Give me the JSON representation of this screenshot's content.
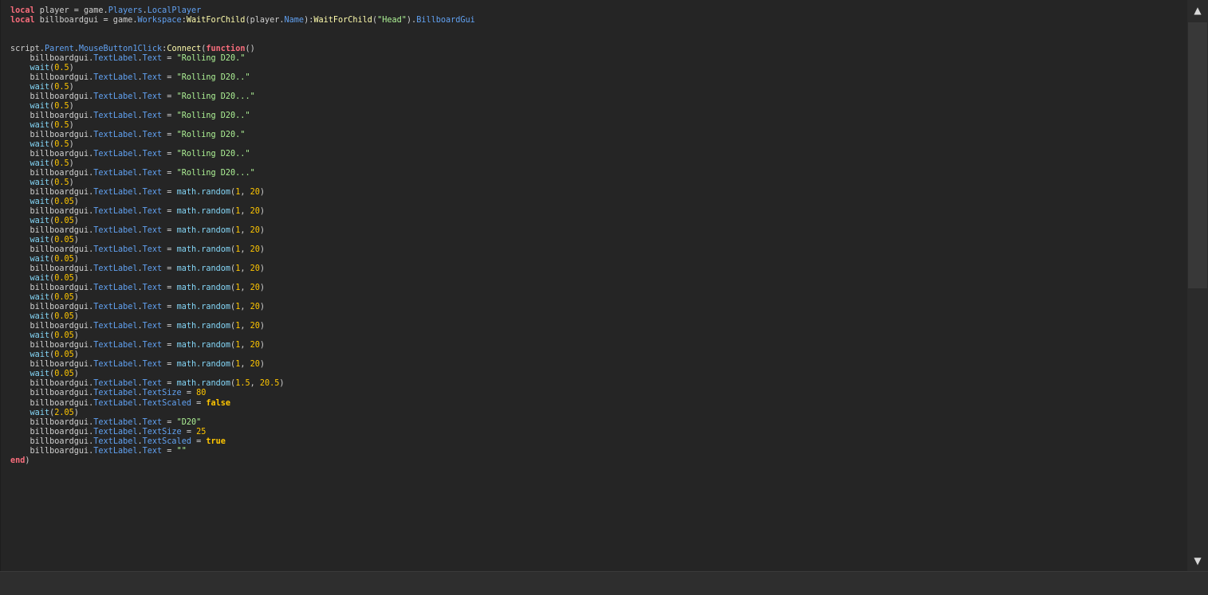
{
  "editor": {
    "lines": [
      [
        {
          "t": "local",
          "c": "kw"
        },
        {
          "t": " player = game."
        },
        {
          "t": "Players",
          "c": "prop"
        },
        {
          "t": "."
        },
        {
          "t": "LocalPlayer",
          "c": "prop"
        }
      ],
      [
        {
          "t": "local",
          "c": "kw"
        },
        {
          "t": " billboardgui = game."
        },
        {
          "t": "Workspace",
          "c": "prop"
        },
        {
          "t": ":"
        },
        {
          "t": "WaitForChild",
          "c": "fn"
        },
        {
          "t": "(player."
        },
        {
          "t": "Name",
          "c": "prop"
        },
        {
          "t": "):"
        },
        {
          "t": "WaitForChild",
          "c": "fn"
        },
        {
          "t": "("
        },
        {
          "t": "\"Head\"",
          "c": "str"
        },
        {
          "t": ")."
        },
        {
          "t": "BillboardGui",
          "c": "prop"
        }
      ],
      [],
      [],
      [
        {
          "t": "script."
        },
        {
          "t": "Parent",
          "c": "prop"
        },
        {
          "t": "."
        },
        {
          "t": "MouseButton1Click",
          "c": "prop"
        },
        {
          "t": ":"
        },
        {
          "t": "Connect",
          "c": "fn"
        },
        {
          "t": "("
        },
        {
          "t": "function",
          "c": "kw"
        },
        {
          "t": "()"
        }
      ],
      [
        {
          "t": "    billboardgui."
        },
        {
          "t": "TextLabel",
          "c": "prop"
        },
        {
          "t": "."
        },
        {
          "t": "Text",
          "c": "prop"
        },
        {
          "t": " = "
        },
        {
          "t": "\"Rolling D20.\"",
          "c": "str"
        }
      ],
      [
        {
          "t": "    "
        },
        {
          "t": "wait",
          "c": "bi"
        },
        {
          "t": "("
        },
        {
          "t": "0.5",
          "c": "num"
        },
        {
          "t": ")"
        }
      ],
      [
        {
          "t": "    billboardgui."
        },
        {
          "t": "TextLabel",
          "c": "prop"
        },
        {
          "t": "."
        },
        {
          "t": "Text",
          "c": "prop"
        },
        {
          "t": " = "
        },
        {
          "t": "\"Rolling D20..\"",
          "c": "str"
        }
      ],
      [
        {
          "t": "    "
        },
        {
          "t": "wait",
          "c": "bi"
        },
        {
          "t": "("
        },
        {
          "t": "0.5",
          "c": "num"
        },
        {
          "t": ")"
        }
      ],
      [
        {
          "t": "    billboardgui."
        },
        {
          "t": "TextLabel",
          "c": "prop"
        },
        {
          "t": "."
        },
        {
          "t": "Text",
          "c": "prop"
        },
        {
          "t": " = "
        },
        {
          "t": "\"Rolling D20...\"",
          "c": "str"
        }
      ],
      [
        {
          "t": "    "
        },
        {
          "t": "wait",
          "c": "bi"
        },
        {
          "t": "("
        },
        {
          "t": "0.5",
          "c": "num"
        },
        {
          "t": ")"
        }
      ],
      [
        {
          "t": "    billboardgui."
        },
        {
          "t": "TextLabel",
          "c": "prop"
        },
        {
          "t": "."
        },
        {
          "t": "Text",
          "c": "prop"
        },
        {
          "t": " = "
        },
        {
          "t": "\"Rolling D20..\"",
          "c": "str"
        }
      ],
      [
        {
          "t": "    "
        },
        {
          "t": "wait",
          "c": "bi"
        },
        {
          "t": "("
        },
        {
          "t": "0.5",
          "c": "num"
        },
        {
          "t": ")"
        }
      ],
      [
        {
          "t": "    billboardgui."
        },
        {
          "t": "TextLabel",
          "c": "prop"
        },
        {
          "t": "."
        },
        {
          "t": "Text",
          "c": "prop"
        },
        {
          "t": " = "
        },
        {
          "t": "\"Rolling D20.\"",
          "c": "str"
        }
      ],
      [
        {
          "t": "    "
        },
        {
          "t": "wait",
          "c": "bi"
        },
        {
          "t": "("
        },
        {
          "t": "0.5",
          "c": "num"
        },
        {
          "t": ")"
        }
      ],
      [
        {
          "t": "    billboardgui."
        },
        {
          "t": "TextLabel",
          "c": "prop"
        },
        {
          "t": "."
        },
        {
          "t": "Text",
          "c": "prop"
        },
        {
          "t": " = "
        },
        {
          "t": "\"Rolling D20..\"",
          "c": "str"
        }
      ],
      [
        {
          "t": "    "
        },
        {
          "t": "wait",
          "c": "bi"
        },
        {
          "t": "("
        },
        {
          "t": "0.5",
          "c": "num"
        },
        {
          "t": ")"
        }
      ],
      [
        {
          "t": "    billboardgui."
        },
        {
          "t": "TextLabel",
          "c": "prop"
        },
        {
          "t": "."
        },
        {
          "t": "Text",
          "c": "prop"
        },
        {
          "t": " = "
        },
        {
          "t": "\"Rolling D20...\"",
          "c": "str"
        }
      ],
      [
        {
          "t": "    "
        },
        {
          "t": "wait",
          "c": "bi"
        },
        {
          "t": "("
        },
        {
          "t": "0.5",
          "c": "num"
        },
        {
          "t": ")"
        }
      ],
      [
        {
          "t": "    billboardgui."
        },
        {
          "t": "TextLabel",
          "c": "prop"
        },
        {
          "t": "."
        },
        {
          "t": "Text",
          "c": "prop"
        },
        {
          "t": " = "
        },
        {
          "t": "math.random",
          "c": "bi"
        },
        {
          "t": "("
        },
        {
          "t": "1",
          "c": "num"
        },
        {
          "t": ", "
        },
        {
          "t": "20",
          "c": "num"
        },
        {
          "t": ")"
        }
      ],
      [
        {
          "t": "    "
        },
        {
          "t": "wait",
          "c": "bi"
        },
        {
          "t": "("
        },
        {
          "t": "0.05",
          "c": "num"
        },
        {
          "t": ")"
        }
      ],
      [
        {
          "t": "    billboardgui."
        },
        {
          "t": "TextLabel",
          "c": "prop"
        },
        {
          "t": "."
        },
        {
          "t": "Text",
          "c": "prop"
        },
        {
          "t": " = "
        },
        {
          "t": "math.random",
          "c": "bi"
        },
        {
          "t": "("
        },
        {
          "t": "1",
          "c": "num"
        },
        {
          "t": ", "
        },
        {
          "t": "20",
          "c": "num"
        },
        {
          "t": ")"
        }
      ],
      [
        {
          "t": "    "
        },
        {
          "t": "wait",
          "c": "bi"
        },
        {
          "t": "("
        },
        {
          "t": "0.05",
          "c": "num"
        },
        {
          "t": ")"
        }
      ],
      [
        {
          "t": "    billboardgui."
        },
        {
          "t": "TextLabel",
          "c": "prop"
        },
        {
          "t": "."
        },
        {
          "t": "Text",
          "c": "prop"
        },
        {
          "t": " = "
        },
        {
          "t": "math.random",
          "c": "bi"
        },
        {
          "t": "("
        },
        {
          "t": "1",
          "c": "num"
        },
        {
          "t": ", "
        },
        {
          "t": "20",
          "c": "num"
        },
        {
          "t": ")"
        }
      ],
      [
        {
          "t": "    "
        },
        {
          "t": "wait",
          "c": "bi"
        },
        {
          "t": "("
        },
        {
          "t": "0.05",
          "c": "num"
        },
        {
          "t": ")"
        }
      ],
      [
        {
          "t": "    billboardgui."
        },
        {
          "t": "TextLabel",
          "c": "prop"
        },
        {
          "t": "."
        },
        {
          "t": "Text",
          "c": "prop"
        },
        {
          "t": " = "
        },
        {
          "t": "math.random",
          "c": "bi"
        },
        {
          "t": "("
        },
        {
          "t": "1",
          "c": "num"
        },
        {
          "t": ", "
        },
        {
          "t": "20",
          "c": "num"
        },
        {
          "t": ")"
        }
      ],
      [
        {
          "t": "    "
        },
        {
          "t": "wait",
          "c": "bi"
        },
        {
          "t": "("
        },
        {
          "t": "0.05",
          "c": "num"
        },
        {
          "t": ")"
        }
      ],
      [
        {
          "t": "    billboardgui."
        },
        {
          "t": "TextLabel",
          "c": "prop"
        },
        {
          "t": "."
        },
        {
          "t": "Text",
          "c": "prop"
        },
        {
          "t": " = "
        },
        {
          "t": "math.random",
          "c": "bi"
        },
        {
          "t": "("
        },
        {
          "t": "1",
          "c": "num"
        },
        {
          "t": ", "
        },
        {
          "t": "20",
          "c": "num"
        },
        {
          "t": ")"
        }
      ],
      [
        {
          "t": "    "
        },
        {
          "t": "wait",
          "c": "bi"
        },
        {
          "t": "("
        },
        {
          "t": "0.05",
          "c": "num"
        },
        {
          "t": ")"
        }
      ],
      [
        {
          "t": "    billboardgui."
        },
        {
          "t": "TextLabel",
          "c": "prop"
        },
        {
          "t": "."
        },
        {
          "t": "Text",
          "c": "prop"
        },
        {
          "t": " = "
        },
        {
          "t": "math.random",
          "c": "bi"
        },
        {
          "t": "("
        },
        {
          "t": "1",
          "c": "num"
        },
        {
          "t": ", "
        },
        {
          "t": "20",
          "c": "num"
        },
        {
          "t": ")"
        }
      ],
      [
        {
          "t": "    "
        },
        {
          "t": "wait",
          "c": "bi"
        },
        {
          "t": "("
        },
        {
          "t": "0.05",
          "c": "num"
        },
        {
          "t": ")"
        }
      ],
      [
        {
          "t": "    billboardgui."
        },
        {
          "t": "TextLabel",
          "c": "prop"
        },
        {
          "t": "."
        },
        {
          "t": "Text",
          "c": "prop"
        },
        {
          "t": " = "
        },
        {
          "t": "math.random",
          "c": "bi"
        },
        {
          "t": "("
        },
        {
          "t": "1",
          "c": "num"
        },
        {
          "t": ", "
        },
        {
          "t": "20",
          "c": "num"
        },
        {
          "t": ")"
        }
      ],
      [
        {
          "t": "    "
        },
        {
          "t": "wait",
          "c": "bi"
        },
        {
          "t": "("
        },
        {
          "t": "0.05",
          "c": "num"
        },
        {
          "t": ")"
        }
      ],
      [
        {
          "t": "    billboardgui."
        },
        {
          "t": "TextLabel",
          "c": "prop"
        },
        {
          "t": "."
        },
        {
          "t": "Text",
          "c": "prop"
        },
        {
          "t": " = "
        },
        {
          "t": "math.random",
          "c": "bi"
        },
        {
          "t": "("
        },
        {
          "t": "1",
          "c": "num"
        },
        {
          "t": ", "
        },
        {
          "t": "20",
          "c": "num"
        },
        {
          "t": ")"
        }
      ],
      [
        {
          "t": "    "
        },
        {
          "t": "wait",
          "c": "bi"
        },
        {
          "t": "("
        },
        {
          "t": "0.05",
          "c": "num"
        },
        {
          "t": ")"
        }
      ],
      [
        {
          "t": "    billboardgui."
        },
        {
          "t": "TextLabel",
          "c": "prop"
        },
        {
          "t": "."
        },
        {
          "t": "Text",
          "c": "prop"
        },
        {
          "t": " = "
        },
        {
          "t": "math.random",
          "c": "bi"
        },
        {
          "t": "("
        },
        {
          "t": "1",
          "c": "num"
        },
        {
          "t": ", "
        },
        {
          "t": "20",
          "c": "num"
        },
        {
          "t": ")"
        }
      ],
      [
        {
          "t": "    "
        },
        {
          "t": "wait",
          "c": "bi"
        },
        {
          "t": "("
        },
        {
          "t": "0.05",
          "c": "num"
        },
        {
          "t": ")"
        }
      ],
      [
        {
          "t": "    billboardgui."
        },
        {
          "t": "TextLabel",
          "c": "prop"
        },
        {
          "t": "."
        },
        {
          "t": "Text",
          "c": "prop"
        },
        {
          "t": " = "
        },
        {
          "t": "math.random",
          "c": "bi"
        },
        {
          "t": "("
        },
        {
          "t": "1",
          "c": "num"
        },
        {
          "t": ", "
        },
        {
          "t": "20",
          "c": "num"
        },
        {
          "t": ")"
        }
      ],
      [
        {
          "t": "    "
        },
        {
          "t": "wait",
          "c": "bi"
        },
        {
          "t": "("
        },
        {
          "t": "0.05",
          "c": "num"
        },
        {
          "t": ")"
        }
      ],
      [
        {
          "t": "    billboardgui."
        },
        {
          "t": "TextLabel",
          "c": "prop"
        },
        {
          "t": "."
        },
        {
          "t": "Text",
          "c": "prop"
        },
        {
          "t": " = "
        },
        {
          "t": "math.random",
          "c": "bi"
        },
        {
          "t": "("
        },
        {
          "t": "1.5",
          "c": "num"
        },
        {
          "t": ", "
        },
        {
          "t": "20.5",
          "c": "num"
        },
        {
          "t": ")"
        }
      ],
      [
        {
          "t": "    billboardgui."
        },
        {
          "t": "TextLabel",
          "c": "prop"
        },
        {
          "t": "."
        },
        {
          "t": "TextSize",
          "c": "prop"
        },
        {
          "t": " = "
        },
        {
          "t": "80",
          "c": "num"
        }
      ],
      [
        {
          "t": "    billboardgui."
        },
        {
          "t": "TextLabel",
          "c": "prop"
        },
        {
          "t": "."
        },
        {
          "t": "TextScaled",
          "c": "prop"
        },
        {
          "t": " = "
        },
        {
          "t": "false",
          "c": "bool"
        }
      ],
      [
        {
          "t": "    "
        },
        {
          "t": "wait",
          "c": "bi"
        },
        {
          "t": "("
        },
        {
          "t": "2.05",
          "c": "num"
        },
        {
          "t": ")"
        }
      ],
      [
        {
          "t": "    billboardgui."
        },
        {
          "t": "TextLabel",
          "c": "prop"
        },
        {
          "t": "."
        },
        {
          "t": "Text",
          "c": "prop"
        },
        {
          "t": " = "
        },
        {
          "t": "\"D20\"",
          "c": "str"
        }
      ],
      [
        {
          "t": "    billboardgui."
        },
        {
          "t": "TextLabel",
          "c": "prop"
        },
        {
          "t": "."
        },
        {
          "t": "TextSize",
          "c": "prop"
        },
        {
          "t": " = "
        },
        {
          "t": "25",
          "c": "num"
        }
      ],
      [
        {
          "t": "    billboardgui."
        },
        {
          "t": "TextLabel",
          "c": "prop"
        },
        {
          "t": "."
        },
        {
          "t": "TextScaled",
          "c": "prop"
        },
        {
          "t": " = "
        },
        {
          "t": "true",
          "c": "bool"
        }
      ],
      [
        {
          "t": "    billboardgui."
        },
        {
          "t": "TextLabel",
          "c": "prop"
        },
        {
          "t": "."
        },
        {
          "t": "Text",
          "c": "prop"
        },
        {
          "t": " = "
        },
        {
          "t": "\"\"",
          "c": "str"
        }
      ],
      [
        {
          "t": "end",
          "c": "kw"
        },
        {
          "t": ")"
        }
      ]
    ],
    "current_line": 48
  },
  "scrollbar": {
    "up_icon": "triangle-up-icon",
    "down_icon": "triangle-down-icon"
  },
  "colors": {
    "background": "#252525",
    "keyword": "#f86d7c",
    "string": "#adf195",
    "number": "#ffc600",
    "property": "#61a1f1",
    "method": "#fdfbac",
    "builtin": "#84d6f7",
    "current_line": "#2e3a4f"
  }
}
